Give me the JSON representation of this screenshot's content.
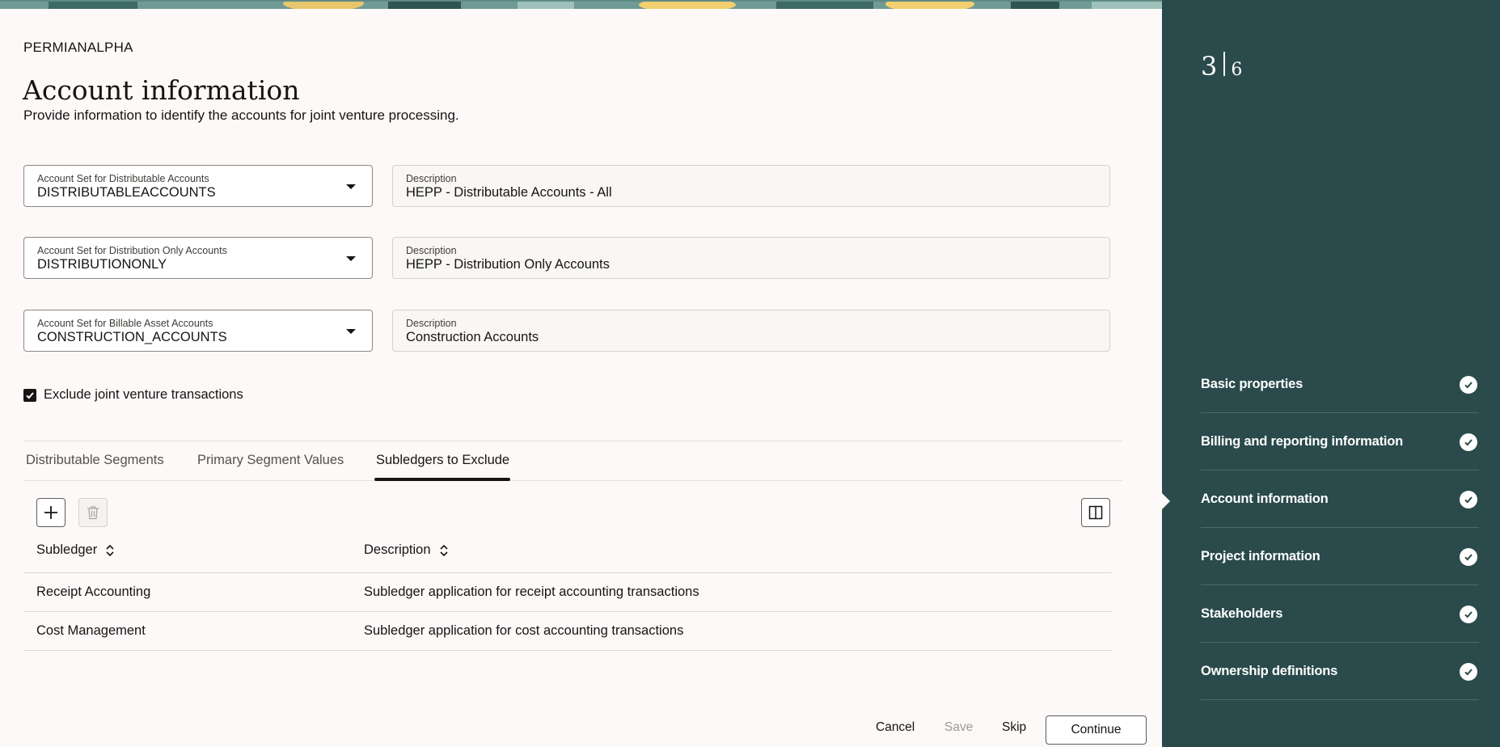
{
  "header": {
    "eyebrow": "PERMIANALPHA",
    "title": "Account information",
    "subtitle": "Provide information to identify the accounts for joint venture processing."
  },
  "fields": {
    "distributable": {
      "label": "Account Set for Distributable Accounts",
      "value": "DISTRIBUTABLEACCOUNTS"
    },
    "distributable_desc": {
      "label": "Description",
      "value": "HEPP - Distributable Accounts - All"
    },
    "distribution_only": {
      "label": "Account Set for Distribution Only Accounts",
      "value": "DISTRIBUTIONONLY"
    },
    "distribution_only_desc": {
      "label": "Description",
      "value": "HEPP - Distribution Only Accounts"
    },
    "billable_asset": {
      "label": "Account Set for Billable Asset Accounts",
      "value": "CONSTRUCTION_ACCOUNTS"
    },
    "billable_asset_desc": {
      "label": "Description",
      "value": "Construction Accounts"
    }
  },
  "exclude_checkbox": {
    "label": "Exclude joint venture transactions",
    "checked": true
  },
  "tabs": [
    {
      "label": "Distributable Segments",
      "active": false
    },
    {
      "label": "Primary Segment Values",
      "active": false
    },
    {
      "label": "Subledgers to Exclude",
      "active": true
    }
  ],
  "toolbar": {
    "add_icon": "plus-icon",
    "delete_icon": "trash-icon",
    "columns_icon": "column-panel-icon"
  },
  "table": {
    "columns": [
      "Subledger",
      "Description"
    ],
    "rows": [
      [
        "Receipt Accounting",
        "Subledger application for receipt accounting transactions"
      ],
      [
        "Cost Management",
        "Subledger application for cost accounting transactions"
      ]
    ]
  },
  "footer": {
    "cancel": "Cancel",
    "save": "Save",
    "skip": "Skip",
    "continue": "Continue"
  },
  "sidebar": {
    "current_step": "3",
    "total_steps": "6",
    "steps": [
      {
        "label": "Basic properties",
        "completed": true,
        "current": false
      },
      {
        "label": "Billing and reporting information",
        "completed": true,
        "current": false
      },
      {
        "label": "Account information",
        "completed": true,
        "current": true
      },
      {
        "label": "Project information",
        "completed": true,
        "current": false
      },
      {
        "label": "Stakeholders",
        "completed": true,
        "current": false
      },
      {
        "label": "Ownership definitions",
        "completed": true,
        "current": false
      }
    ]
  },
  "colors": {
    "sidebar_bg": "#2a4a4b",
    "page_bg": "#fcf9f8",
    "text": "#161513"
  }
}
